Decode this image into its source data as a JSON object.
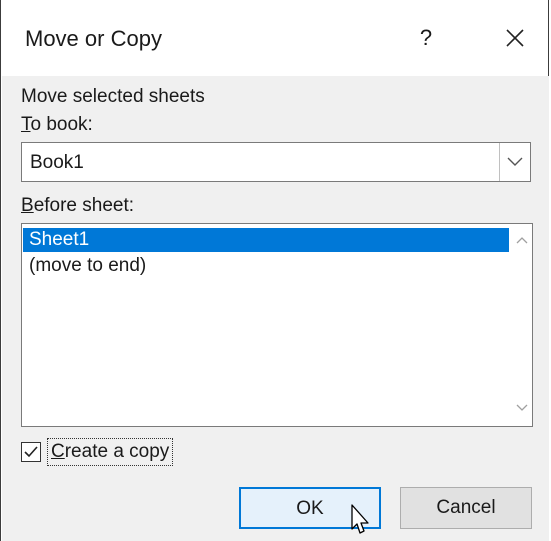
{
  "dialog": {
    "title": "Move or Copy",
    "help_glyph": "?",
    "close_icon": "close-icon"
  },
  "section": {
    "heading": "Move selected sheets"
  },
  "to_book": {
    "label_accel": "T",
    "label_rest": "o book:",
    "value": "Book1",
    "dropdown_icon": "chevron-down-icon"
  },
  "before_sheet": {
    "label_accel": "B",
    "label_rest": "efore sheet:",
    "items": [
      {
        "label": "Sheet1",
        "selected": true
      },
      {
        "label": "(move to end)",
        "selected": false
      }
    ]
  },
  "create_copy": {
    "label_accel": "C",
    "label_rest": "reate a copy",
    "checked": true
  },
  "buttons": {
    "ok": "OK",
    "cancel": "Cancel"
  },
  "colors": {
    "selection": "#0078d7",
    "body_bg": "#f0f0f0",
    "default_button_bg": "#e5f1fb"
  }
}
